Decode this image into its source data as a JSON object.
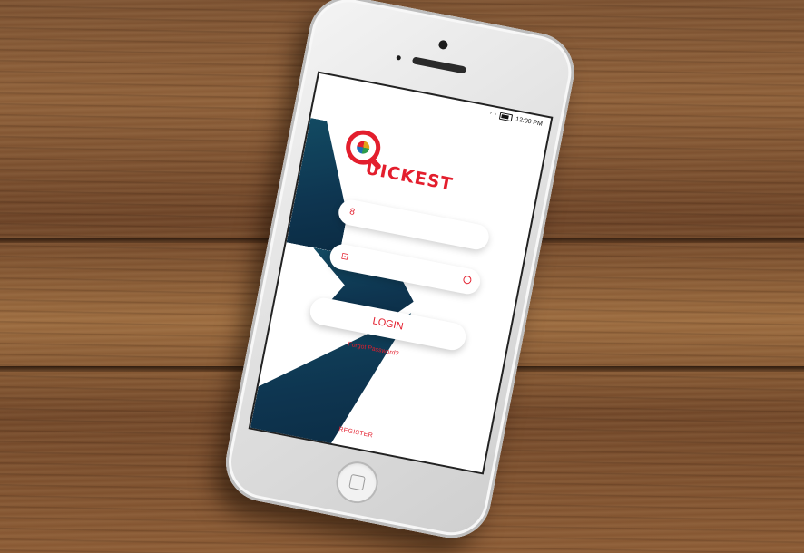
{
  "status_bar": {
    "time": "12:00 PM"
  },
  "logo": {
    "text": "UICKEST",
    "brand_color": "#e31e2d"
  },
  "login_form": {
    "username_placeholder": "",
    "password_placeholder": "",
    "login_label": "LOGIN",
    "forgot_password_label": "Forgot Password?"
  },
  "footer": {
    "register_label": "REGISTER"
  },
  "colors": {
    "accent": "#e31e2d",
    "shape": "#0e3550",
    "background": "#ffffff"
  },
  "icons": {
    "username": "user-icon",
    "password": "lock-icon",
    "toggle": "eye-icon"
  }
}
